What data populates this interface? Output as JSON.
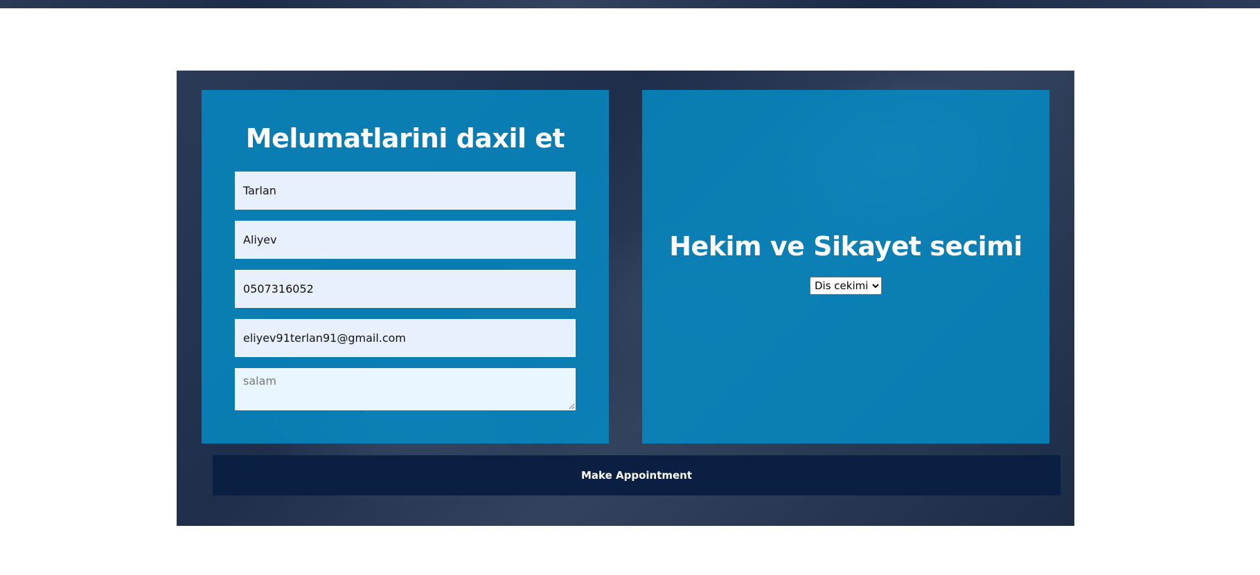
{
  "form": {
    "title": "Melumatlarini daxil et",
    "first_name": "Tarlan",
    "last_name": "Aliyev",
    "phone": "0507316052",
    "email": "eliyev91terlan91@gmail.com",
    "message": "salam"
  },
  "selection": {
    "title": "Hekim ve Sikayet secimi",
    "selected_option": "Dis cekimi"
  },
  "submit": {
    "label": "Make Appointment"
  },
  "colors": {
    "panel": "#0689c4",
    "button": "#0b1f42",
    "section_overlay": "#2b3b57"
  }
}
